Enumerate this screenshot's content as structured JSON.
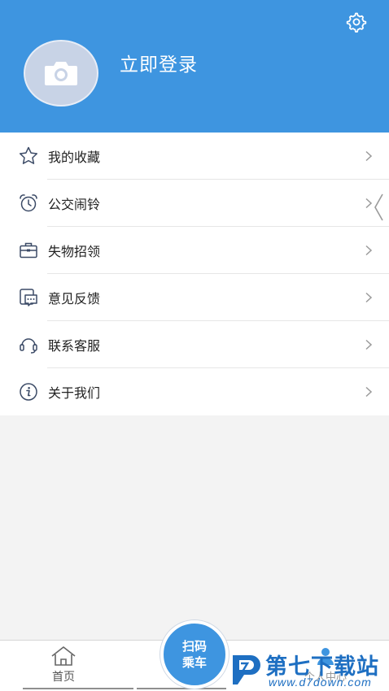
{
  "header": {
    "login_label": "立即登录",
    "settings_icon": "gear-icon",
    "avatar_icon": "camera-icon",
    "background_color": "#3e95e0"
  },
  "menu": {
    "items": [
      {
        "label": "我的收藏",
        "icon": "star-icon"
      },
      {
        "label": "公交闹铃",
        "icon": "alarm-clock-icon"
      },
      {
        "label": "失物招领",
        "icon": "briefcase-icon"
      },
      {
        "label": "意见反馈",
        "icon": "feedback-icon"
      },
      {
        "label": "联系客服",
        "icon": "headset-icon"
      },
      {
        "label": "关于我们",
        "icon": "info-icon"
      }
    ]
  },
  "tabbar": {
    "home_label": "首页",
    "scan_line1": "扫码",
    "scan_line2": "乘车",
    "mine_label": "个人中心"
  },
  "watermark": {
    "title": "第七下载站",
    "url": "www.d7down.com"
  }
}
